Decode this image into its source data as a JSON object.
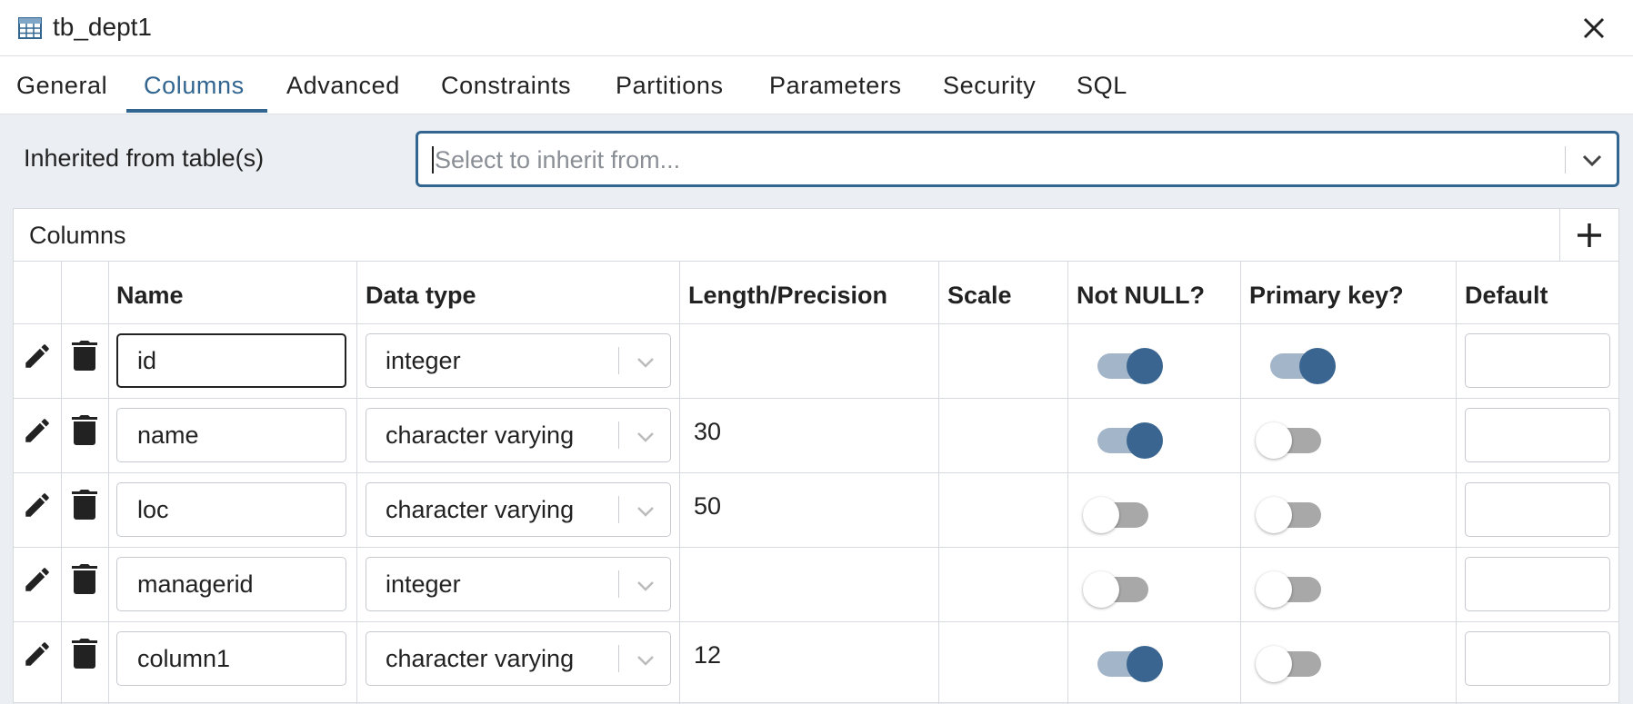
{
  "window": {
    "title": "tb_dept1",
    "icon": "table-icon",
    "close_icon": "close-icon"
  },
  "tabs": [
    {
      "label": "General",
      "active": false
    },
    {
      "label": "Columns",
      "active": true
    },
    {
      "label": "Advanced",
      "active": false
    },
    {
      "label": "Constraints",
      "active": false
    },
    {
      "label": "Partitions",
      "active": false
    },
    {
      "label": "Parameters",
      "active": false
    },
    {
      "label": "Security",
      "active": false
    },
    {
      "label": "SQL",
      "active": false
    }
  ],
  "inherit": {
    "label": "Inherited from table(s)",
    "placeholder": "Select to inherit from...",
    "value": ""
  },
  "columns_panel": {
    "title": "Columns",
    "add_icon": "plus-icon",
    "headers": [
      "Name",
      "Data type",
      "Length/Precision",
      "Scale",
      "Not NULL?",
      "Primary key?",
      "Default"
    ],
    "rows": [
      {
        "name": "id",
        "data_type": "integer",
        "length": "",
        "scale": "",
        "not_null": true,
        "primary_key": true,
        "default": ""
      },
      {
        "name": "name",
        "data_type": "character varying",
        "length": "30",
        "scale": "",
        "not_null": true,
        "primary_key": false,
        "default": ""
      },
      {
        "name": "loc",
        "data_type": "character varying",
        "length": "50",
        "scale": "",
        "not_null": false,
        "primary_key": false,
        "default": ""
      },
      {
        "name": "managerid",
        "data_type": "integer",
        "length": "",
        "scale": "",
        "not_null": false,
        "primary_key": false,
        "default": ""
      },
      {
        "name": "column1",
        "data_type": "character varying",
        "length": "12",
        "scale": "",
        "not_null": true,
        "primary_key": false,
        "default": ""
      }
    ]
  },
  "colors": {
    "accent": "#326690",
    "toggle_on_knob": "#3a6591",
    "toggle_on_track": "#a3b5c8",
    "toggle_off_track": "#a8a8a8",
    "background": "#ebeef3"
  }
}
